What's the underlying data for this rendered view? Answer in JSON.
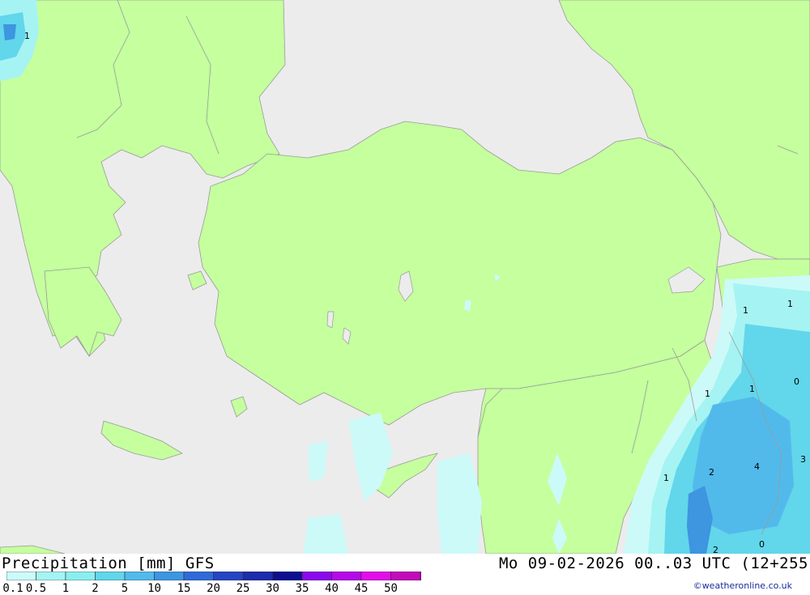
{
  "title": {
    "left": "Precipitation [mm] GFS",
    "right": "Mo 09-02-2026 00..03 UTC (12+255"
  },
  "credit": "©weatheronline.co.uk",
  "colors": {
    "land": "#c5ff9e",
    "sea": "#ececec",
    "border": "#9a9a9a"
  },
  "scale": {
    "values": [
      "0.1",
      "0.5",
      "1",
      "2",
      "5",
      "10",
      "15",
      "20",
      "25",
      "30",
      "35",
      "40",
      "45",
      "50"
    ],
    "colors": [
      "#ccfaf9",
      "#a6f3f3",
      "#8aeef0",
      "#62d6eb",
      "#52baeb",
      "#3e95e0",
      "#2f6ad8",
      "#2545c2",
      "#1c2cab",
      "#0d0f8f",
      "#8a0aeb",
      "#b40be8",
      "#e20ee8",
      "#c10cb8",
      "#a20aa0"
    ]
  },
  "value_labels": [
    "1",
    "1",
    "1",
    "0",
    "1",
    "1",
    "1",
    "2",
    "4",
    "3",
    "0",
    "2"
  ]
}
